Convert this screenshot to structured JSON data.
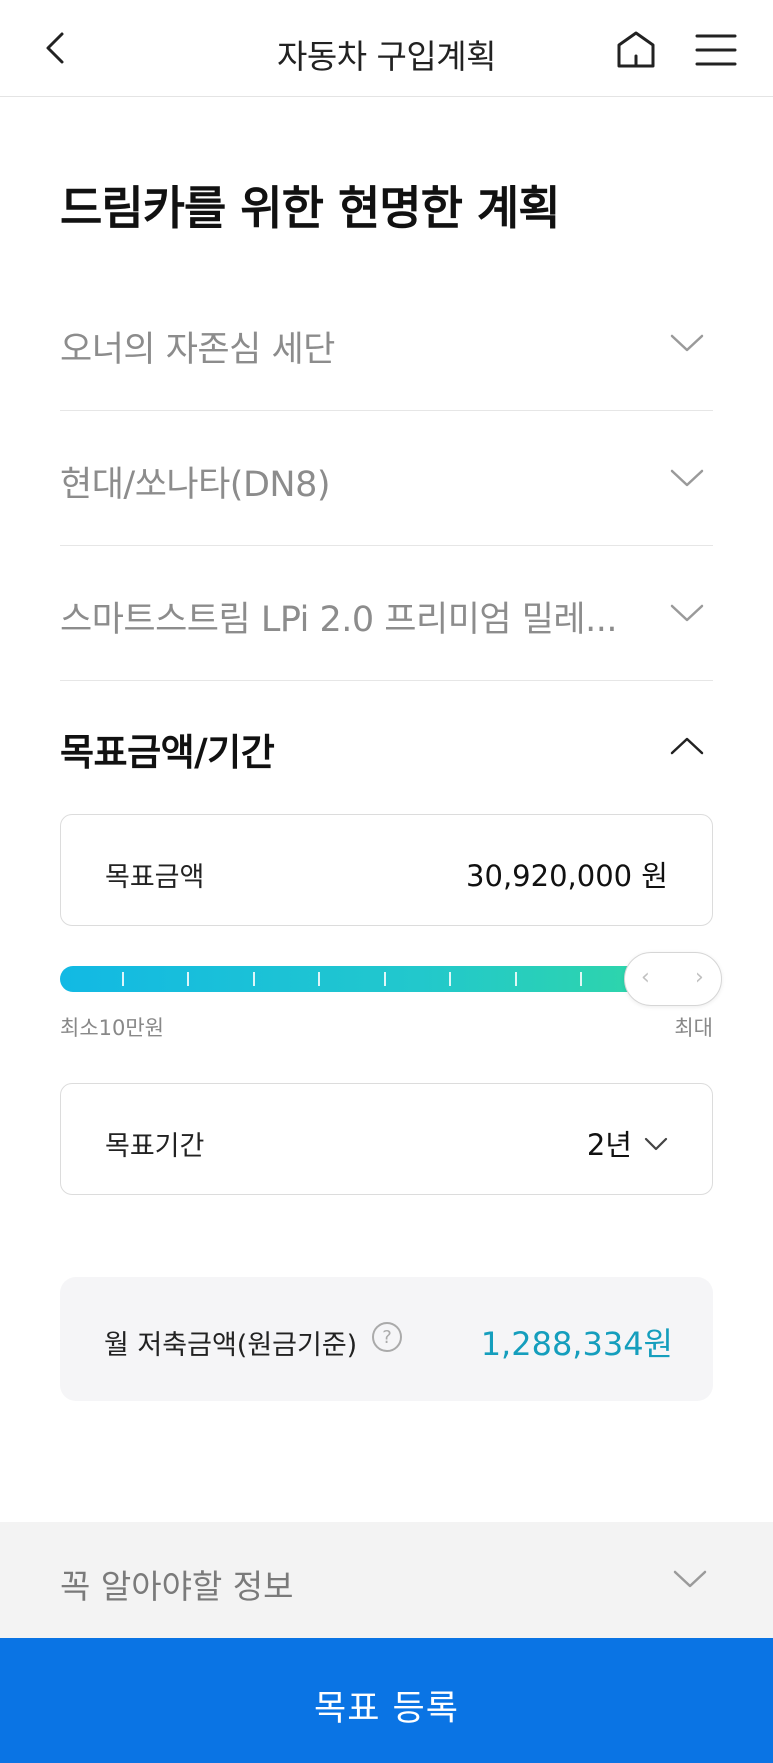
{
  "header": {
    "title": "자동차 구입계획"
  },
  "page": {
    "title": "드림카를 위한 현명한 계획"
  },
  "selections": [
    {
      "label": "오너의 자존심 세단"
    },
    {
      "label": "현대/쏘나타(DN8)"
    },
    {
      "label": "스마트스트림 LPi 2.0 프리미엄 밀레..."
    }
  ],
  "goal_section": {
    "title": "목표금액/기간",
    "amount_label": "목표금액",
    "amount_value": "30,920,000 원",
    "slider": {
      "min_label": "최소10만원",
      "max_label": "최대",
      "level": 1.0
    },
    "period_label": "목표기간",
    "period_value": "2년"
  },
  "monthly": {
    "label": "월 저축금액(원금기준)",
    "value": "1,288,334원"
  },
  "info": {
    "label": "꼭 알아야할 정보"
  },
  "cta": {
    "label": "목표 등록"
  },
  "colors": {
    "accent_blue": "#0a74e4",
    "value_teal": "#159ebd",
    "slider_start": "#12b9e4",
    "slider_end": "#2fd6a8"
  }
}
